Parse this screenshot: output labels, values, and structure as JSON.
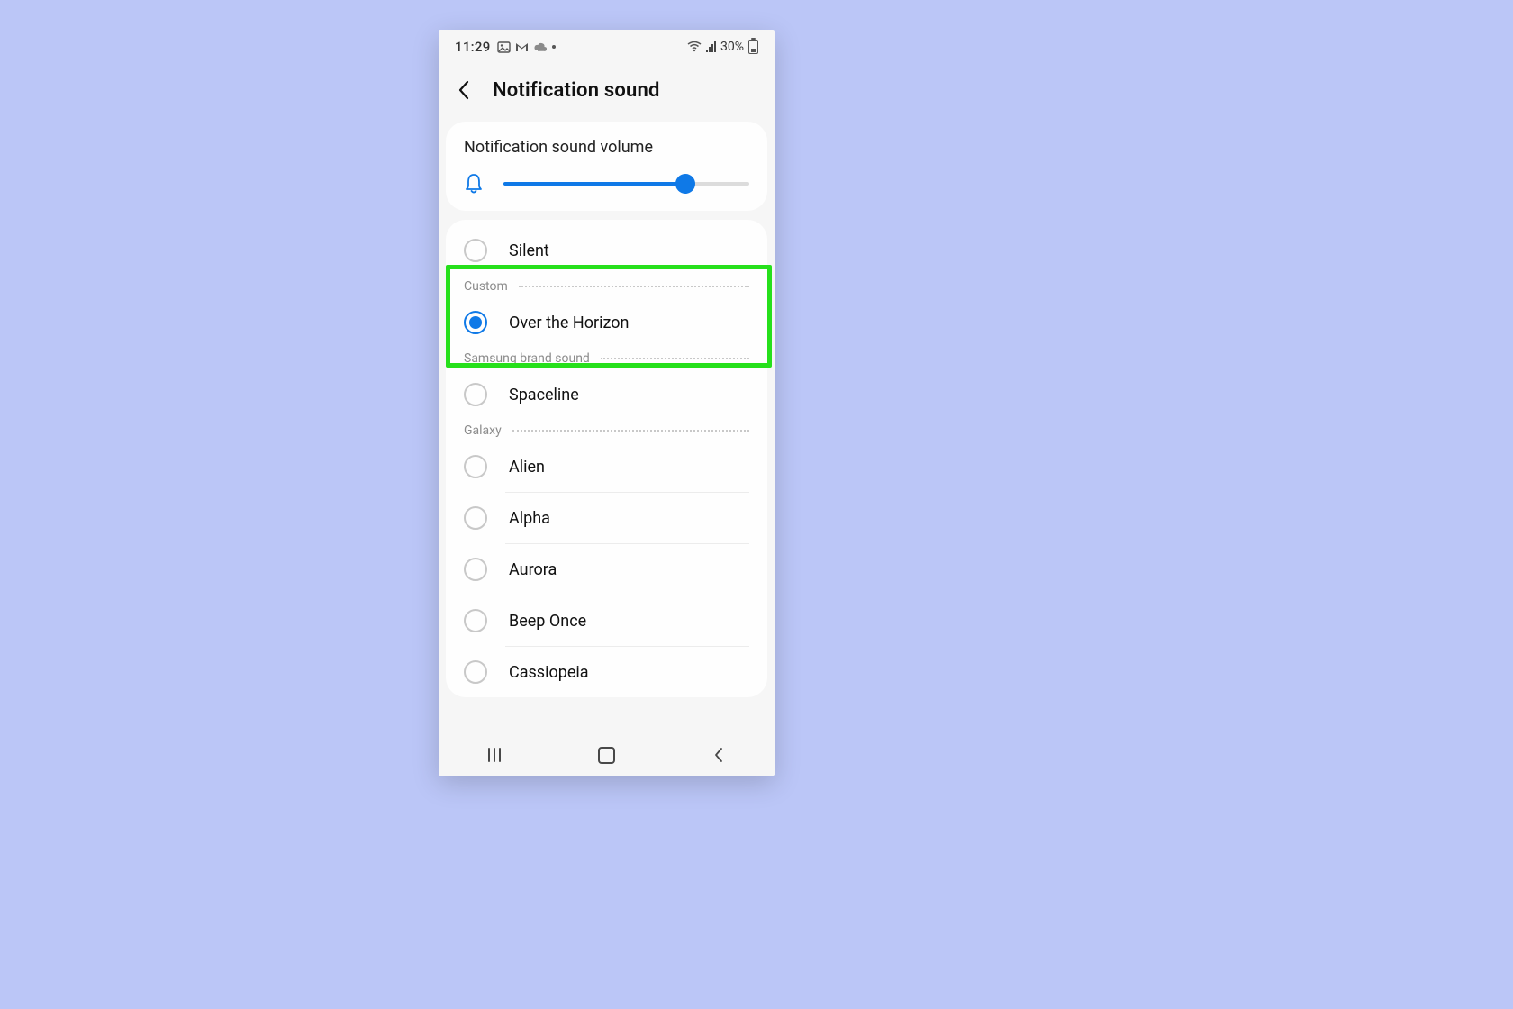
{
  "status": {
    "time": "11:29",
    "battery_text": "30%"
  },
  "header": {
    "title": "Notification sound"
  },
  "volume": {
    "label": "Notification sound volume",
    "percent": 74
  },
  "colors": {
    "accent": "#0F79E7",
    "highlight": "#26E01B"
  },
  "sections": [
    {
      "id": "top",
      "label": "",
      "items": [
        {
          "id": "silent",
          "label": "Silent",
          "selected": false
        }
      ]
    },
    {
      "id": "custom",
      "label": "Custom",
      "highlighted": true,
      "items": [
        {
          "id": "over-the-horizon",
          "label": "Over the Horizon",
          "selected": true
        }
      ]
    },
    {
      "id": "samsung",
      "label": "Samsung brand sound",
      "items": [
        {
          "id": "spaceline",
          "label": "Spaceline",
          "selected": false
        }
      ]
    },
    {
      "id": "galaxy",
      "label": "Galaxy",
      "items": [
        {
          "id": "alien",
          "label": "Alien",
          "selected": false
        },
        {
          "id": "alpha",
          "label": "Alpha",
          "selected": false
        },
        {
          "id": "aurora",
          "label": "Aurora",
          "selected": false
        },
        {
          "id": "beep-once",
          "label": "Beep Once",
          "selected": false
        },
        {
          "id": "cassiopeia",
          "label": "Cassiopeia",
          "selected": false
        }
      ]
    }
  ]
}
